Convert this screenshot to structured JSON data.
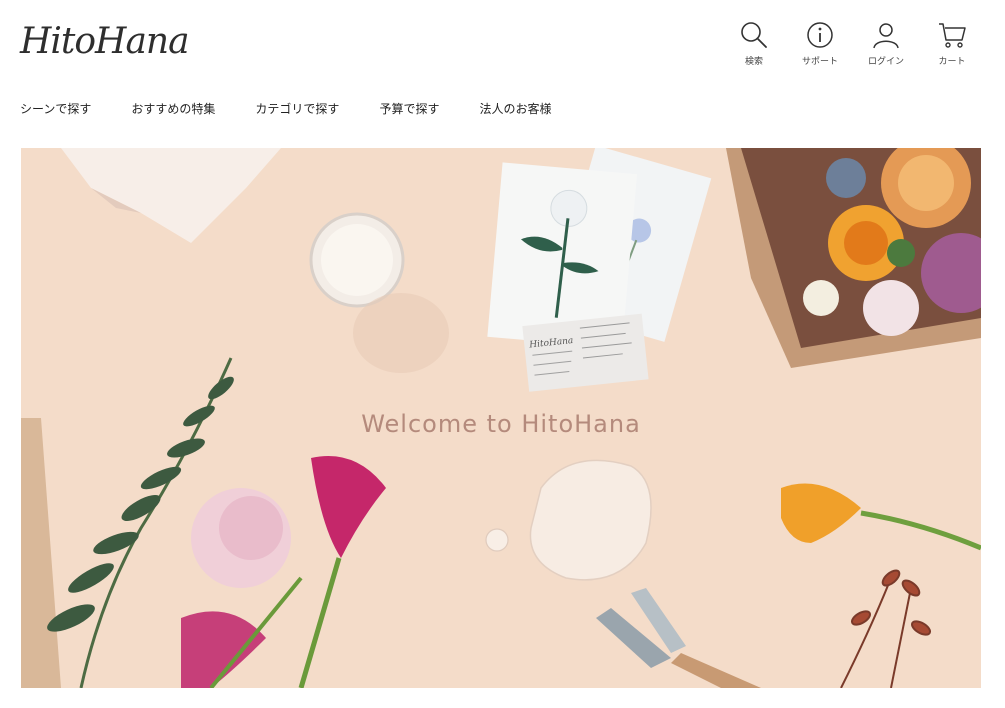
{
  "header": {
    "logo": "HitoHana",
    "icons": [
      {
        "label": "検索",
        "icon": "search-icon"
      },
      {
        "label": "サポート",
        "icon": "info-icon"
      },
      {
        "label": "ログイン",
        "icon": "user-icon"
      },
      {
        "label": "カート",
        "icon": "cart-icon"
      }
    ]
  },
  "nav": {
    "items": [
      {
        "label": "シーンで探す"
      },
      {
        "label": "おすすめの特集"
      },
      {
        "label": "カテゴリで探す"
      },
      {
        "label": "予算で探す"
      },
      {
        "label": "法人のお客様"
      }
    ]
  },
  "hero": {
    "title": "Welcome to HitoHana",
    "card_brand": "HitoHana",
    "colors": {
      "background": "#f4dcc9",
      "title": "#b48a7c"
    }
  }
}
